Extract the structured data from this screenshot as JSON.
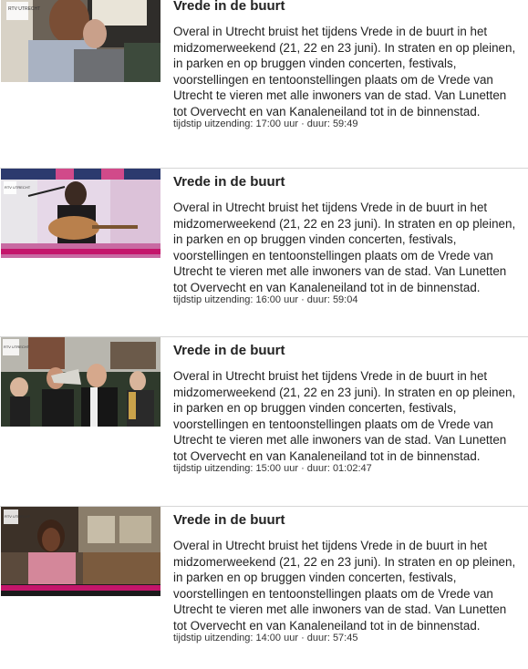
{
  "items": [
    {
      "title": "Vrede in de buurt",
      "description": "Overal in Utrecht bruist het tijdens Vrede in de buurt in het midzomerweekend (21, 22 en 23 juni). In straten en op pleinen, in parken en op bruggen vinden concerten, festivals, voorstellingen en tentoonstellingen plaats om de Vrede van Utrecht te vieren met alle inwoners van de stad. Van Lunetten tot Overvecht en van Kanaleneiland tot in de binnenstad.",
      "meta_label": "tijdstip uitzending:",
      "time": "17:00 uur",
      "separator": "·",
      "duration_label": "duur:",
      "duration": "59:49",
      "thumb_logo": "RTV UTRECHT"
    },
    {
      "title": "Vrede in de buurt",
      "description": "Overal in Utrecht bruist het tijdens Vrede in de buurt in het midzomerweekend (21, 22 en 23 juni). In straten en op pleinen, in parken en op bruggen vinden concerten, festivals, voorstellingen en tentoonstellingen plaats om de Vrede van Utrecht te vieren met alle inwoners van de stad. Van Lunetten tot Overvecht en van Kanaleneiland tot in de binnenstad.",
      "meta_label": "tijdstip uitzending:",
      "time": "16:00 uur",
      "separator": "·",
      "duration_label": "duur:",
      "duration": "59:04",
      "thumb_logo": "RTV UTRECHT"
    },
    {
      "title": "Vrede in de buurt",
      "description": "Overal in Utrecht bruist het tijdens Vrede in de buurt in het midzomerweekend (21, 22 en 23 juni). In straten en op pleinen, in parken en op bruggen vinden concerten, festivals, voorstellingen en tentoonstellingen plaats om de Vrede van Utrecht te vieren met alle inwoners van de stad. Van Lunetten tot Overvecht en van Kanaleneiland tot in de binnenstad.",
      "meta_label": "tijdstip uitzending:",
      "time": "15:00 uur",
      "separator": "·",
      "duration_label": "duur:",
      "duration": "01:02:47",
      "thumb_logo": "RTV UTRECHT"
    },
    {
      "title": "Vrede in de buurt",
      "description": "Overal in Utrecht bruist het tijdens Vrede in de buurt in het midzomerweekend (21, 22 en 23 juni). In straten en op pleinen, in parken en op bruggen vinden concerten, festivals, voorstellingen en tentoonstellingen plaats om de Vrede van Utrecht te vieren met alle inwoners van de stad. Van Lunetten tot Overvecht en van Kanaleneiland tot in de binnenstad.",
      "meta_label": "tijdstip uitzending:",
      "time": "14:00 uur",
      "separator": "·",
      "duration_label": "duur:",
      "duration": "57:45",
      "thumb_logo": "RTV UTRECHT"
    }
  ],
  "colors": {
    "separator": "#d6d6d6",
    "text": "#222222",
    "ticker_magenta": "#c4156b"
  }
}
